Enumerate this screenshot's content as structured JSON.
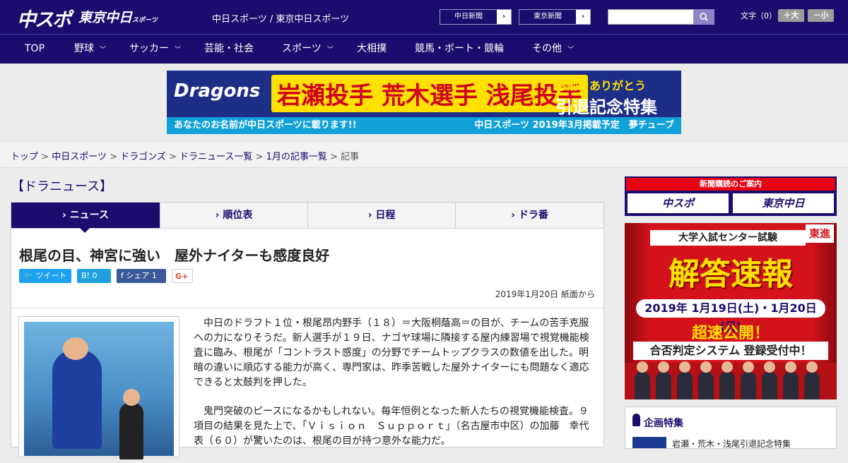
{
  "header": {
    "logo_main": "中スポ",
    "logo_sub": "東京中日",
    "logo_sub_small": "スポーツ",
    "site_name": "中日スポーツ / 東京中日スポーツ",
    "site_links": [
      {
        "label": "中日新聞",
        "arrow": "›"
      },
      {
        "label": "東京新聞",
        "arrow": "›"
      }
    ],
    "search": {
      "placeholder": "",
      "icon": "search-icon"
    },
    "font_size_label": "文字（0）",
    "font_plus": "＋大",
    "font_minus": "－小"
  },
  "nav": {
    "items": [
      {
        "label": "TOP",
        "dropdown": false
      },
      {
        "label": "野球",
        "dropdown": true
      },
      {
        "label": "サッカー",
        "dropdown": true
      },
      {
        "label": "芸能・社会",
        "dropdown": false
      },
      {
        "label": "スポーツ",
        "dropdown": true
      },
      {
        "label": "大相撲",
        "dropdown": false
      },
      {
        "label": "競馬・ボート・競輪",
        "dropdown": false
      },
      {
        "label": "その他",
        "dropdown": true
      }
    ],
    "chevron": "﹀"
  },
  "banner": {
    "logo": "Dragons",
    "names": "岩瀬投手 荒木選手 浅尾投手",
    "thanks": "感動をありがとう",
    "special": "引退記念特集",
    "bottom_left": "あなたのお名前が中日スポーツに載ります!!",
    "bottom_right": "中日スポーツ 2019年3月掲載予定　夢チューブ"
  },
  "breadcrumb": {
    "links": [
      "トップ",
      "中日スポーツ",
      "ドラゴンズ",
      "ドラニュース一覧",
      "1月の記事一覧"
    ],
    "current": "記事",
    "separator": " > "
  },
  "section_title": "【ドラニュース】",
  "tabs": [
    {
      "label": "› ニュース",
      "active": true
    },
    {
      "label": "› 順位表",
      "active": false
    },
    {
      "label": "› 日程",
      "active": false
    },
    {
      "label": "› ドラ番",
      "active": false
    }
  ],
  "article": {
    "headline": "根尾の目、神宮に強い　屋外ナイターも感度良好",
    "share": [
      {
        "label": "ツイート",
        "icon": "twitter-icon",
        "color": "#1da1f2"
      },
      {
        "label": "B! 0",
        "icon": "hatena-icon",
        "color": "#1fa1df"
      },
      {
        "label": "シェア 1",
        "icon": "facebook-icon",
        "color": "#3b5998"
      },
      {
        "label": "G+",
        "icon": "google-plus-icon",
        "color": "#ffffff"
      }
    ],
    "date": "2019年1月20日 紙面から",
    "paragraphs": [
      "中日のドラフト１位・根尾昂内野手（１８）＝大阪桐蔭高＝の目が、チームの苦手克服への力になりそうだ。新人選手が１９日、ナゴヤ球場に隣接する屋内練習場で視覚機能検査に臨み、根尾が「コントラスト感度」の分野でチームトップクラスの数値を出した。明暗の違いに順応する能力が高く、専門家は、昨季苦戦した屋外ナイターにも問題なく適応できると太鼓判を押した。",
      "鬼門突破のピースになるかもしれない。毎年恒例となった新人たちの視覚機能検査。９項目の結果を見た上で、「Ｖｉｓｉｏｎ　Ｓｕｐｐｏｒｔ」（名古屋市中区）の加藤　幸代表（６０）が驚いたのは、根尾の目が持つ意外な能力だ。"
    ]
  },
  "sidebar": {
    "subscribe_head": "新聞購読のご案内",
    "subscribe_buttons": [
      "中スポ",
      "東京中日"
    ],
    "ad": {
      "top": "大学入試センター試験",
      "brand": "東進",
      "main": "解答速報",
      "dates": "2019年 1月19日(土)・1月20日(日)",
      "fast": "超速公開！",
      "system": "合否判定システム 登録受付中！"
    },
    "feature_title": "企画特集",
    "feature_item": "岩瀬・荒木・浅尾引退記念特集"
  },
  "colors": {
    "brand_navy": "#1a0d6e",
    "accent_red": "#e60012",
    "banner_yellow": "#ffe100"
  }
}
